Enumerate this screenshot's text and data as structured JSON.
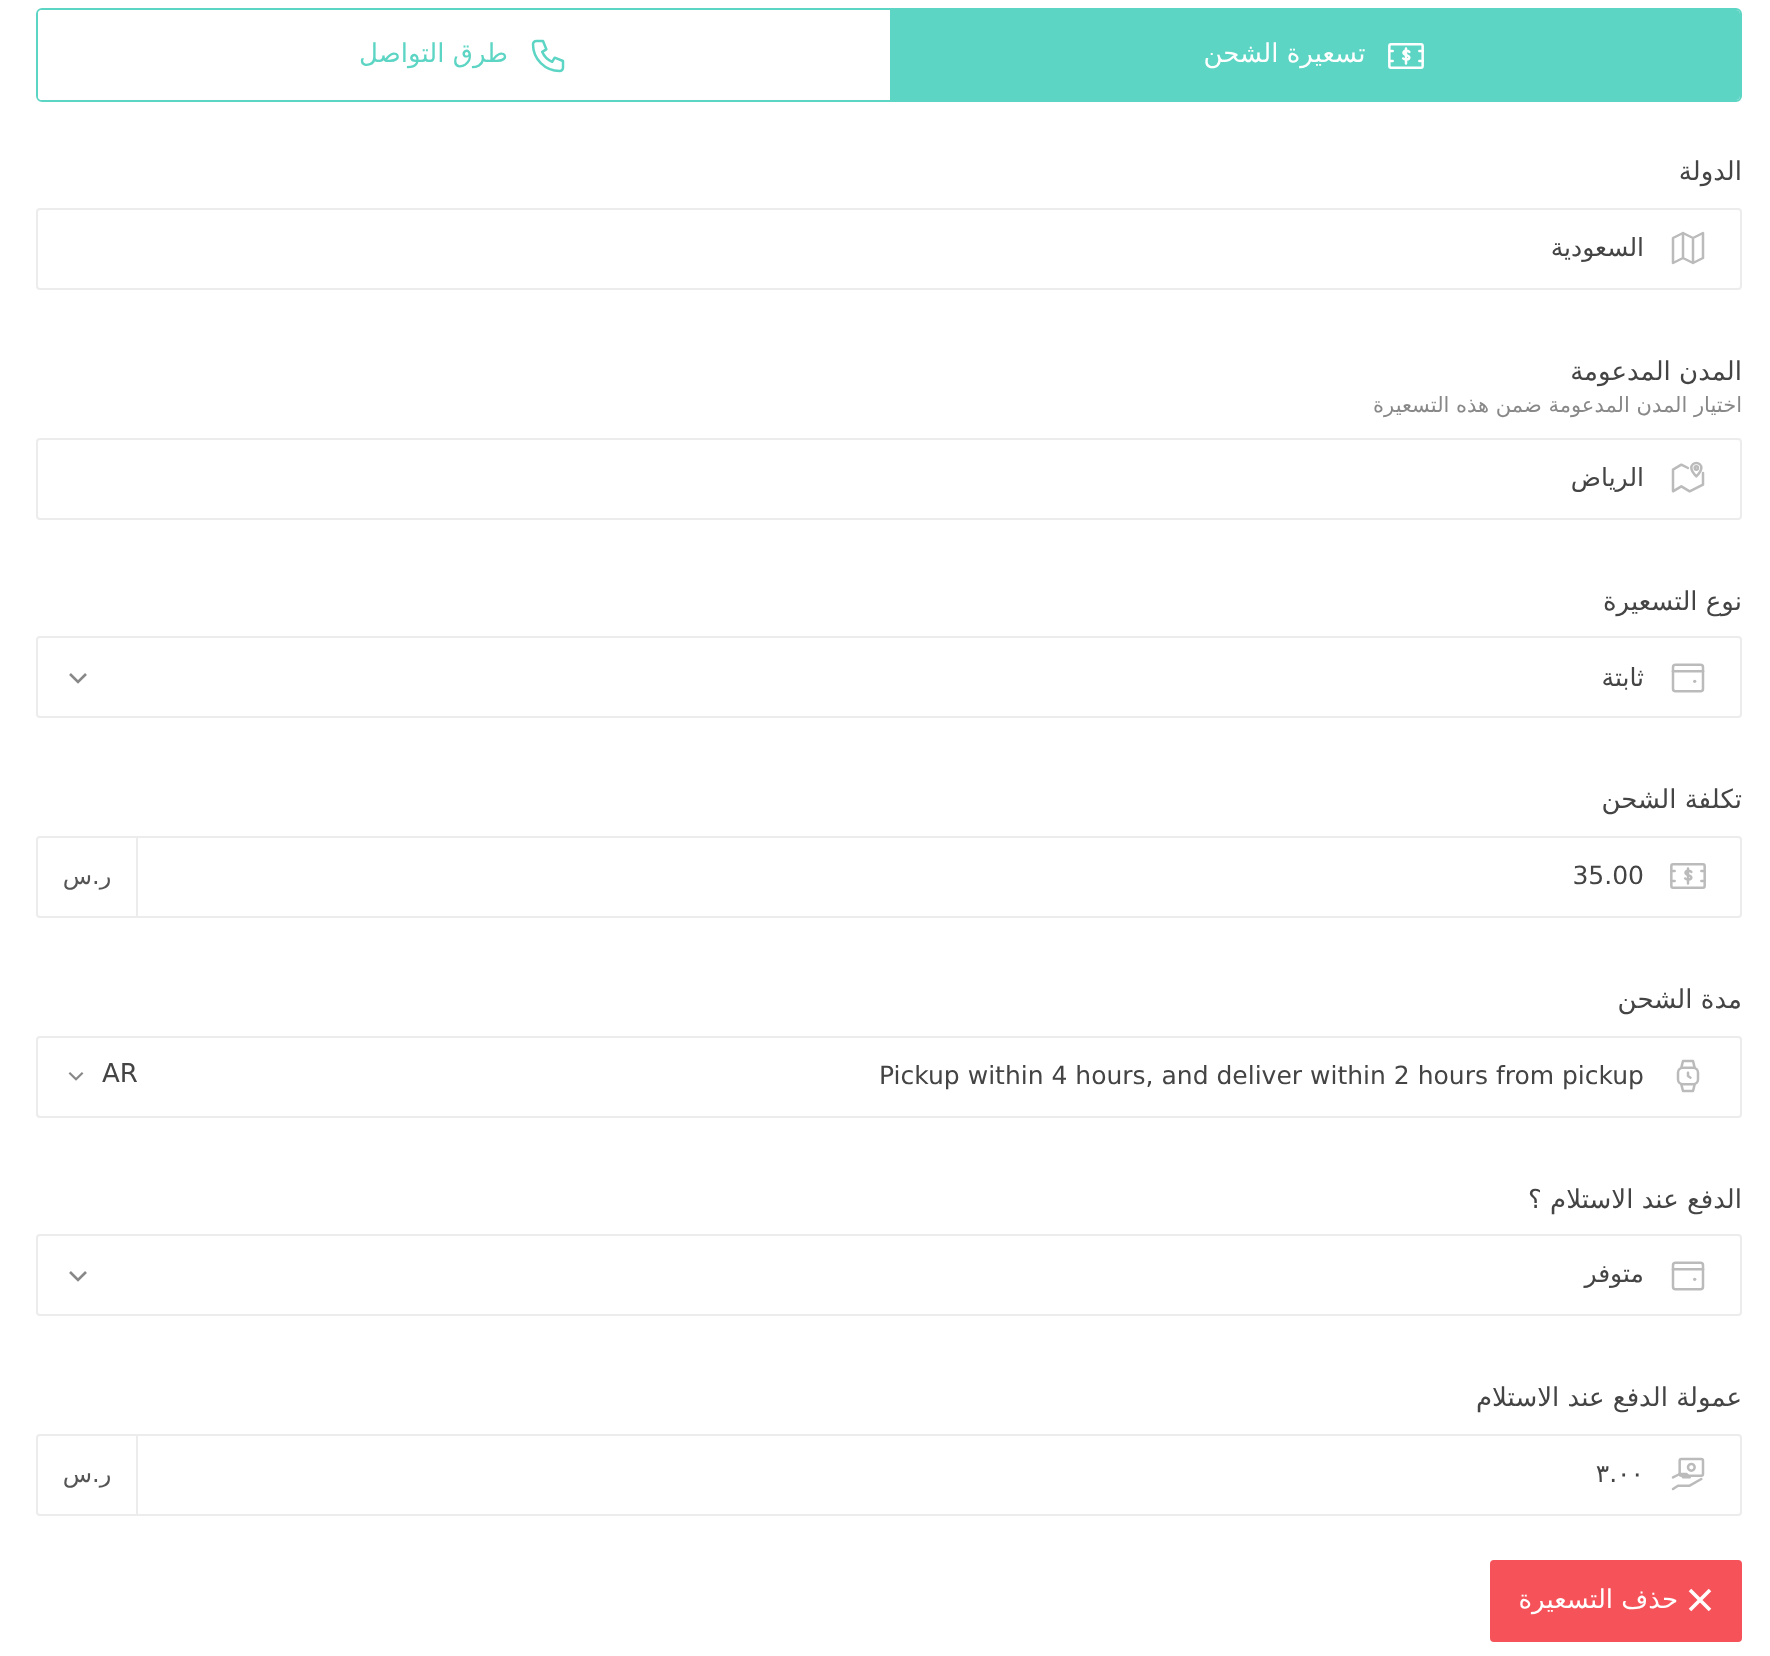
{
  "tabs": [
    {
      "label": "تسعيرة الشحن",
      "selected": true
    },
    {
      "label": "طرق التواصل",
      "selected": false
    }
  ],
  "fields": [
    {
      "kind": "input",
      "label": "الدولة",
      "value": "السعودية"
    },
    {
      "kind": "input",
      "label": "المدن المدعومة",
      "hint": "اختيار المدن المدعومة ضمن هذه التسعيرة",
      "value": "الرياض"
    },
    {
      "kind": "select",
      "label": "نوع التسعيرة",
      "value": "ثابتة"
    },
    {
      "kind": "currency",
      "label": "تكلفة الشحن",
      "value": "35.00",
      "unit": "ر.س"
    },
    {
      "kind": "language",
      "label": "مدة الشحن",
      "value": "Pickup within 4 hours, and deliver within 2 hours from pickup",
      "language": "AR"
    },
    {
      "kind": "select",
      "label": "الدفع عند الاستلام ؟",
      "value": "متوفر"
    },
    {
      "kind": "currency",
      "label": "عمولة الدفع عند الاستلام",
      "value": "٣.٠٠",
      "unit": "ر.س"
    }
  ],
  "delete_button": {
    "label": "حذف التسعيرة"
  }
}
